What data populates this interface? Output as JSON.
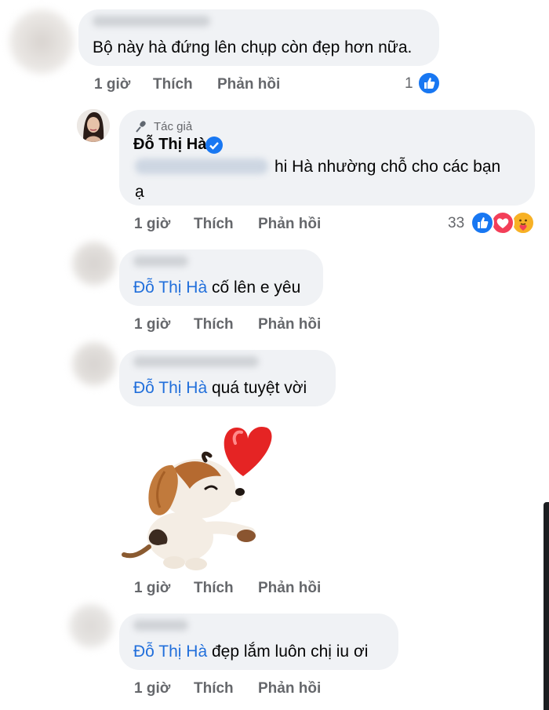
{
  "comments": [
    {
      "text": "Bộ này hà đứng lên chụp còn đẹp hơn nữa.",
      "time": "1 giờ",
      "like": "Thích",
      "reply": "Phản hồi",
      "reaction_count": "1"
    },
    {
      "author_badge": "Tác giả",
      "author": "Đỗ Thị Hà",
      "text_line1": "hi Hà nhường chỗ cho các bạn",
      "text_line2": "ạ",
      "time": "1 giờ",
      "like": "Thích",
      "reply": "Phản hồi",
      "reaction_count": "33"
    },
    {
      "mention": "Đỗ Thị Hà",
      "text": "cố lên e yêu",
      "time": "1 giờ",
      "like": "Thích",
      "reply": "Phản hồi"
    },
    {
      "mention": "Đỗ Thị Hà",
      "text": "quá tuyệt vời",
      "time": "1 giờ",
      "like": "Thích",
      "reply": "Phản hồi"
    },
    {
      "mention": "Đỗ Thị Hà",
      "text": "đẹp lắm luôn chị iu ơi",
      "time": "1 giờ",
      "like": "Thích",
      "reply": "Phản hồi"
    }
  ],
  "icons": {
    "like": "like-reaction-icon",
    "love": "love-reaction-icon",
    "care": "care-reaction-icon",
    "verified": "verified-badge-icon",
    "author": "author-badge-icon",
    "sticker": "puppy-heart-sticker"
  },
  "colors": {
    "bubble": "#f0f2f5",
    "mention": "#216fdb",
    "meta": "#65676b",
    "like": "#1877f2",
    "love": "#f33e58"
  }
}
